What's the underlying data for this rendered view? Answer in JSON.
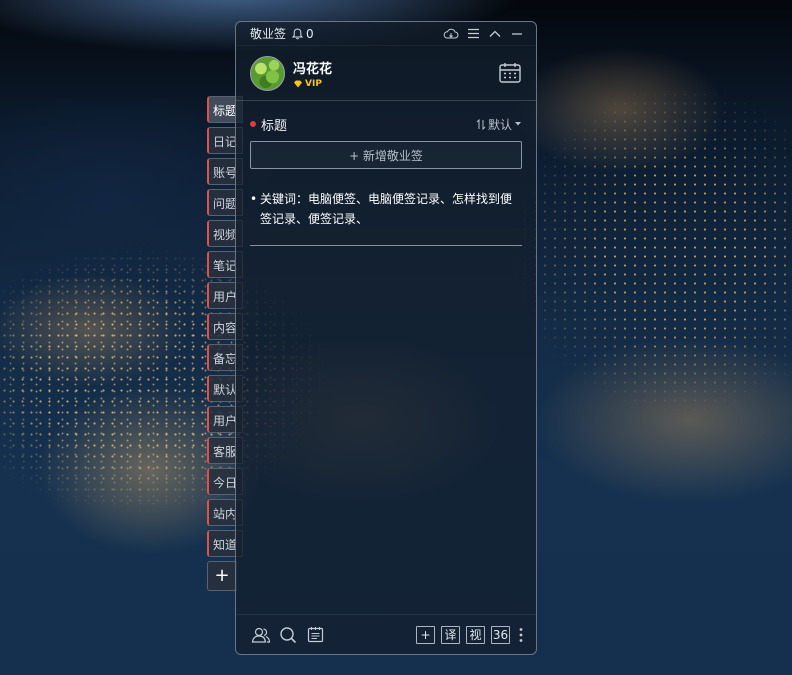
{
  "app": {
    "name": "敬业签",
    "notification_count": "0"
  },
  "user": {
    "name": "冯花花",
    "badge": "VIP"
  },
  "side_tabs": [
    "标题",
    "日记",
    "账号",
    "问题",
    "视频",
    "笔记",
    "用户",
    "内容",
    "备忘",
    "默认",
    "用户",
    "客服",
    "今日",
    "站内",
    "知道"
  ],
  "side_add_label": "+",
  "section": {
    "title": "标题",
    "sort_label": "默认"
  },
  "add_button_label": "+ 新增敬业签",
  "notes": [
    {
      "text": "关键词：电脑便签、电脑便签记录、怎样找到便签记录、便签记录、"
    }
  ],
  "bottom_buttons": {
    "add": "+",
    "translate": "译",
    "view": "视",
    "count": "36"
  },
  "colors": {
    "accent_red": "#e23b3b",
    "vip_gold": "#f5c518"
  }
}
